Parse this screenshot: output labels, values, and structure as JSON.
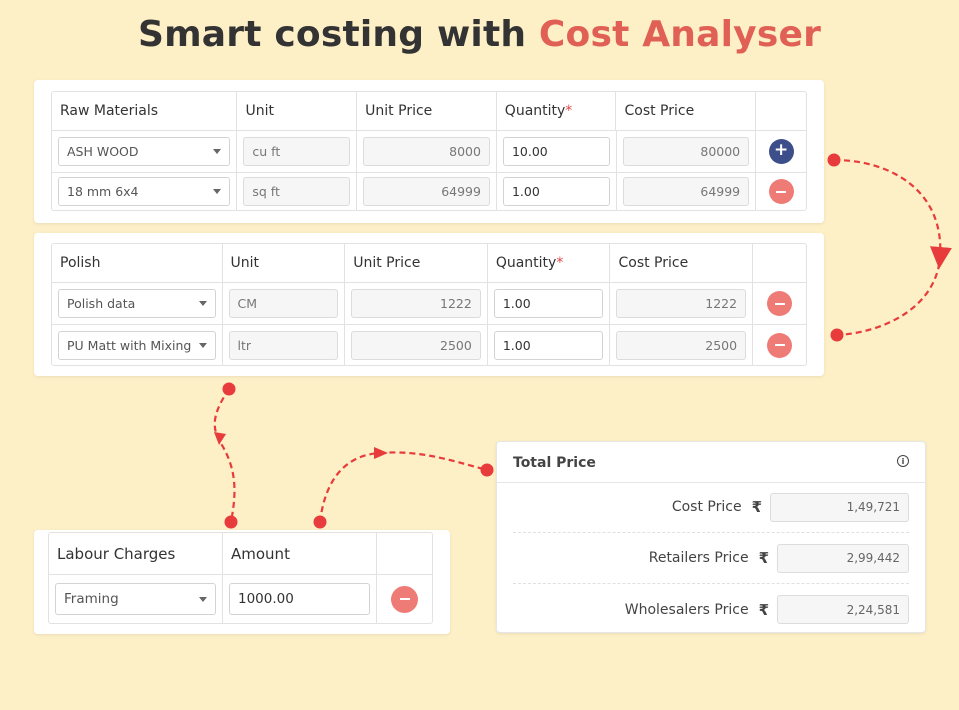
{
  "headline": {
    "prefix": "Smart costing with ",
    "accent": "Cost Analyser"
  },
  "colors": {
    "accent": "#e06055",
    "background": "#fdefc6",
    "add_button": "#3d4f8a",
    "remove_button": "#ef7b76",
    "arrow": "#e83b3b"
  },
  "raw_materials": {
    "headers": [
      "Raw Materials",
      "Unit",
      "Unit Price",
      "Quantity",
      "Cost Price"
    ],
    "required_marker": "*",
    "rows": [
      {
        "material": "ASH WOOD",
        "unit": "cu ft",
        "unit_price": "8000",
        "quantity": "10.00",
        "cost_price": "80000",
        "action": "add"
      },
      {
        "material": "18 mm 6x4",
        "unit": "sq ft",
        "unit_price": "64999",
        "quantity": "1.00",
        "cost_price": "64999",
        "action": "remove"
      }
    ]
  },
  "polish": {
    "headers": [
      "Polish",
      "Unit",
      "Unit Price",
      "Quantity",
      "Cost Price"
    ],
    "required_marker": "*",
    "rows": [
      {
        "material": "Polish data",
        "unit": "CM",
        "unit_price": "1222",
        "quantity": "1.00",
        "cost_price": "1222",
        "action": "remove"
      },
      {
        "material": "PU Matt with Mixing",
        "unit": "ltr",
        "unit_price": "2500",
        "quantity": "1.00",
        "cost_price": "2500",
        "action": "remove"
      }
    ]
  },
  "labour": {
    "headers": [
      "Labour Charges",
      "Amount"
    ],
    "rows": [
      {
        "type": "Framing",
        "amount": "1000.00",
        "action": "remove"
      }
    ]
  },
  "total_price": {
    "title": "Total Price",
    "info_icon": "info-icon",
    "currency_symbol": "₹",
    "rows": [
      {
        "label": "Cost Price",
        "value": "1,49,721"
      },
      {
        "label": "Retailers Price",
        "value": "2,99,442"
      },
      {
        "label": "Wholesalers Price",
        "value": "2,24,581"
      }
    ]
  },
  "icons": {
    "add": "+",
    "info": "i"
  }
}
